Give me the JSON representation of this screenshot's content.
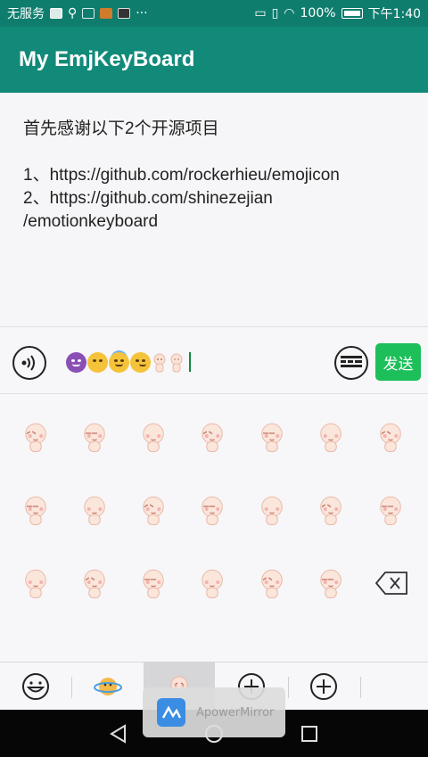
{
  "status_bar": {
    "carrier": "无服务",
    "more": "···",
    "battery_percent": "100%",
    "time": "下午1:40"
  },
  "app": {
    "title": "My EmjKeyBoard"
  },
  "content": {
    "line1": "首先感谢以下2个开源项目",
    "line2": "1、https://github.com/rockerhieu/emojicon",
    "line3": "2、https://github.com/shinezejian",
    "line4": "/emotionkeyboard"
  },
  "input": {
    "emoji_sequence": [
      "devil",
      "neutral-face",
      "angel",
      "smirk",
      "baby",
      "baby"
    ],
    "send_label": "发送"
  },
  "grid": {
    "rows": [
      [
        "baby-heart-eyes",
        "baby-squint",
        "baby-shocked",
        "baby-crying",
        "baby-blush",
        "baby-sleepy",
        "baby-glasses"
      ],
      [
        "baby-dizzy",
        "baby-happy",
        "baby-sad",
        "baby-angry",
        "baby-pout",
        "baby-annoyed",
        "baby-frown"
      ],
      [
        "baby-cute",
        "baby-wink",
        "baby-cry",
        "baby-smile",
        "baby-surprised",
        "baby-tired"
      ]
    ],
    "delete_icon": "backspace-icon"
  },
  "tabs": [
    {
      "icon": "smiley-icon",
      "active": false
    },
    {
      "icon": "planet-icon",
      "active": false
    },
    {
      "icon": "baby-icon",
      "active": true
    },
    {
      "icon": "add-icon",
      "active": false
    },
    {
      "icon": "add-icon",
      "active": false
    }
  ],
  "overlay": {
    "label": "ApowerMirror"
  },
  "colors": {
    "status_bar": "#0f7d6e",
    "app_bar": "#128a79",
    "send_button": "#1dbf5a",
    "cursor": "#0f8a3c"
  }
}
